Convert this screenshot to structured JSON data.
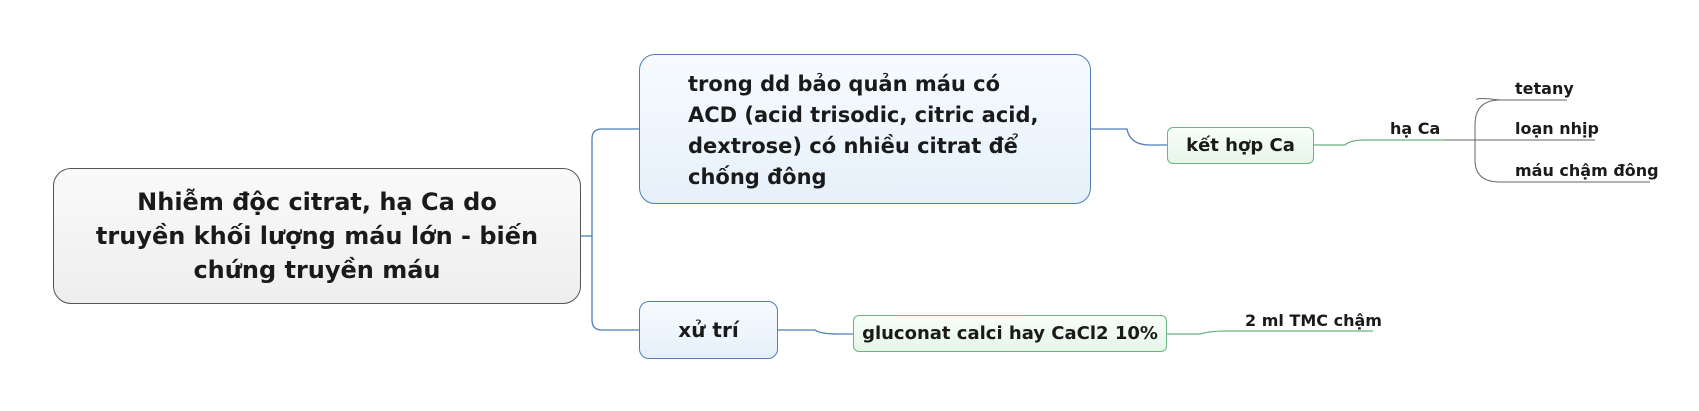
{
  "root": {
    "text": "Nhiễm độc citrat, hạ Ca do truyền khối lượng máu lớn - biến chứng truyền máu"
  },
  "branch1": {
    "text": "trong dd bảo quản máu có ACD (acid trisodic, citric acid, dextrose) có nhiều citrat để chống đông",
    "child": {
      "text": "kết hợp Ca",
      "child": {
        "text": "hạ Ca",
        "children": [
          "tetany",
          "loạn nhịp",
          "máu chậm đông"
        ]
      }
    }
  },
  "branch2": {
    "text": "xử trí",
    "child": {
      "text": "gluconat calci hay CaCl2 10%",
      "child": {
        "text": "2 ml TMC chậm"
      }
    }
  },
  "colors": {
    "blue_line": "#4d7fb5",
    "green_line": "#6bb47c",
    "leaf_line": "#666666"
  }
}
